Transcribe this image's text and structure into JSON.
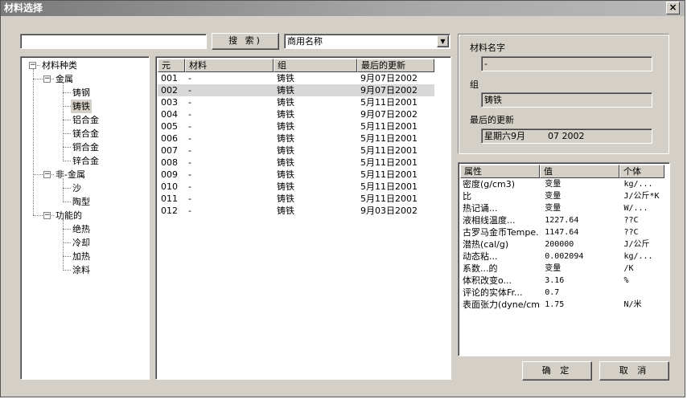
{
  "window": {
    "title": "材料选择",
    "close_glyph": "×"
  },
  "search": {
    "value": "",
    "button_label": "搜 索)",
    "select_value": "商用名称",
    "select_arrow": "▼"
  },
  "tree": {
    "root": "材料种类",
    "groups": [
      {
        "label": "金属",
        "items": [
          "铸钢",
          "铸铁",
          "铝合金",
          "镁合金",
          "铜合金",
          "锌合金"
        ]
      },
      {
        "label": "非-金属",
        "items": [
          "沙",
          "陶型"
        ]
      },
      {
        "label": "功能的",
        "items": [
          "绝热",
          "冷却",
          "加热",
          "涂料"
        ]
      }
    ],
    "selected": "铸铁"
  },
  "table": {
    "headers": [
      "元",
      "材料",
      "组",
      "最后的更新"
    ],
    "rows": [
      [
        "001",
        "-",
        "铸铁",
        "9月07日2002"
      ],
      [
        "002",
        "-",
        "铸铁",
        "9月07日2002"
      ],
      [
        "003",
        "-",
        "铸铁",
        "5月11日2001"
      ],
      [
        "004",
        "-",
        "铸铁",
        "9月07日2002"
      ],
      [
        "005",
        "-",
        "铸铁",
        "5月11日2001"
      ],
      [
        "006",
        "-",
        "铸铁",
        "5月11日2001"
      ],
      [
        "007",
        "-",
        "铸铁",
        "5月11日2001"
      ],
      [
        "008",
        "-",
        "铸铁",
        "5月11日2001"
      ],
      [
        "009",
        "-",
        "铸铁",
        "5月11日2001"
      ],
      [
        "010",
        "-",
        "铸铁",
        "5月11日2001"
      ],
      [
        "011",
        "-",
        "铸铁",
        "5月11日2001"
      ],
      [
        "012",
        "-",
        "铸铁",
        "9月03日2002"
      ]
    ],
    "selected_row": "002"
  },
  "details": {
    "name_label": "材料名字",
    "name_value": "-",
    "group_label": "组",
    "group_value": "铸铁",
    "updated_label": "最后的更新",
    "updated_value": "星期六9月        07 2002"
  },
  "properties": {
    "headers": [
      "属性",
      "值",
      "个体"
    ],
    "rows": [
      [
        "密度(g/cm3)",
        "变量",
        "kg/..."
      ],
      [
        "比",
        "变量",
        "J/公斤*K"
      ],
      [
        "热记诵...",
        "变量",
        "W/..."
      ],
      [
        "液相线温度...",
        "1227.64",
        "??C"
      ],
      [
        "古罗马金币Tempe.",
        "1147.64",
        "??C"
      ],
      [
        "潜热(cal/g)",
        "200000",
        "J/公斤"
      ],
      [
        "动态粘...",
        "0.002094",
        "kg/..."
      ],
      [
        "系数...的",
        "变量",
        "/K"
      ],
      [
        "体积改变o...",
        "3.16",
        "%"
      ],
      [
        "评论的实体Fr...",
        "0.7",
        ""
      ],
      [
        "表面张力(dyne/cm",
        "1.75",
        "N/米"
      ]
    ]
  },
  "buttons": {
    "ok": "确 定",
    "cancel": "取 消"
  }
}
